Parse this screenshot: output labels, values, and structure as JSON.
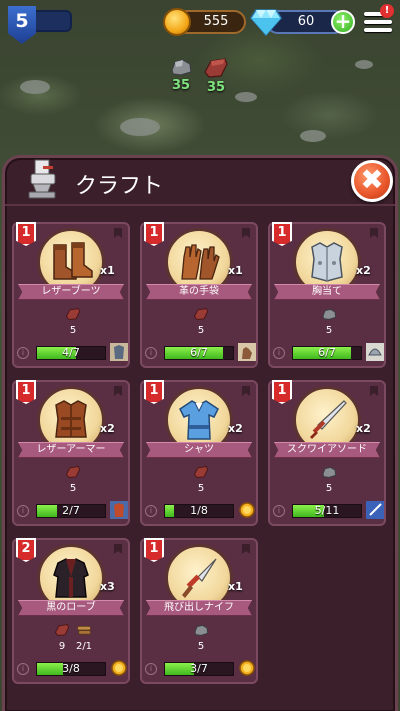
{
  "hud": {
    "level": "5",
    "coins": "555",
    "gems": "60",
    "plus": "+",
    "menu_alert": "!"
  },
  "resources": [
    {
      "icon": "stone-icon",
      "value": "35"
    },
    {
      "icon": "leather-icon",
      "value": "35"
    }
  ],
  "panel": {
    "title": "クラフト",
    "close": "✖"
  },
  "colors": {
    "panel_bg": "#3b1f2a",
    "card_bg": "#5a2f44",
    "ribbon": "#a85a7e",
    "progress_fill": "#3fb81e",
    "tier_badge": "#d72a2a"
  },
  "cards": [
    {
      "tier": "1",
      "name": "レザーブーツ",
      "qty": "x1",
      "item_icon": "leather-boots-icon",
      "materials": [
        {
          "icon": "leather-icon",
          "count": "5"
        }
      ],
      "progress_text": "4/7",
      "progress": 0.571,
      "slot_icon": "armor-icon"
    },
    {
      "tier": "1",
      "name": "革の手袋",
      "qty": "x1",
      "item_icon": "leather-gloves-icon",
      "materials": [
        {
          "icon": "leather-icon",
          "count": "5"
        }
      ],
      "progress_text": "6/7",
      "progress": 0.857,
      "slot_icon": "glove-icon"
    },
    {
      "tier": "1",
      "name": "胸当て",
      "qty": "x2",
      "item_icon": "breastplate-icon",
      "materials": [
        {
          "icon": "stone-icon",
          "count": "5"
        }
      ],
      "progress_text": "6/7",
      "progress": 0.857,
      "slot_icon": "helmet-icon"
    },
    {
      "tier": "1",
      "name": "レザーアーマー",
      "qty": "x2",
      "item_icon": "leather-armor-icon",
      "materials": [
        {
          "icon": "leather-icon",
          "count": "5"
        }
      ],
      "progress_text": "2/7",
      "progress": 0.286,
      "slot_icon": "armor-slot-icon"
    },
    {
      "tier": "1",
      "name": "シャツ",
      "qty": "x2",
      "item_icon": "shirt-icon",
      "materials": [
        {
          "icon": "leather-icon",
          "count": "5"
        }
      ],
      "progress_text": "1/8",
      "progress": 0.125,
      "slot_icon": "coin-icon"
    },
    {
      "tier": "1",
      "name": "スクワイアソード",
      "qty": "x2",
      "item_icon": "sword-icon",
      "materials": [
        {
          "icon": "stone-icon",
          "count": "5"
        }
      ],
      "progress_text": "5/11",
      "progress": 0.455,
      "slot_icon": "sword-slot-icon"
    },
    {
      "tier": "2",
      "name": "黒のローブ",
      "qty": "x3",
      "item_icon": "black-robe-icon",
      "materials": [
        {
          "icon": "leather-icon",
          "count": "9"
        },
        {
          "icon": "wood-icon",
          "count": "2/1"
        }
      ],
      "progress_text": "3/8",
      "progress": 0.375,
      "slot_icon": "coin-icon"
    },
    {
      "tier": "1",
      "name": "飛び出しナイフ",
      "qty": "x1",
      "item_icon": "knife-icon",
      "materials": [
        {
          "icon": "stone-icon",
          "count": "5"
        }
      ],
      "progress_text": "3/7",
      "progress": 0.429,
      "slot_icon": "coin-icon"
    }
  ]
}
